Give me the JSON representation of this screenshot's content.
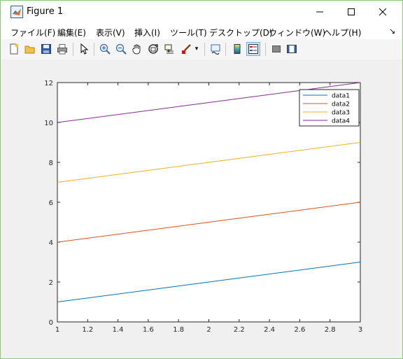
{
  "window": {
    "title": "Figure 1",
    "minimize_glyph": "—",
    "maximize_glyph": "☐",
    "close_glyph": "✕"
  },
  "menu": {
    "items": [
      {
        "id": "file",
        "label": "ファイル(F)"
      },
      {
        "id": "edit",
        "label": "編集(E)"
      },
      {
        "id": "view",
        "label": "表示(V)"
      },
      {
        "id": "insert",
        "label": "挿入(I)"
      },
      {
        "id": "tools",
        "label": "ツール(T)"
      },
      {
        "id": "desktop",
        "label": "デスクトップ(D)"
      },
      {
        "id": "window",
        "label": "ウィンドウ(W)"
      },
      {
        "id": "help",
        "label": "ヘルプ(H)"
      }
    ],
    "dock_glyph": "↘"
  },
  "toolbar": {
    "buttons": [
      {
        "name": "new-figure-icon"
      },
      {
        "name": "open-file-icon"
      },
      {
        "name": "save-icon"
      },
      {
        "name": "print-icon"
      },
      {
        "name": "select-arrow-icon"
      },
      {
        "name": "zoom-in-icon"
      },
      {
        "name": "zoom-out-icon"
      },
      {
        "name": "pan-hand-icon"
      },
      {
        "name": "rotate-3d-icon"
      },
      {
        "name": "data-cursor-icon"
      },
      {
        "name": "brush-icon"
      },
      {
        "name": "link-plot-icon"
      },
      {
        "name": "colorbar-icon"
      },
      {
        "name": "legend-icon"
      },
      {
        "name": "hide-plot-tools-icon"
      },
      {
        "name": "show-plot-tools-icon"
      }
    ],
    "brush_dropdown_glyph": "▾"
  },
  "chart_data": {
    "type": "line",
    "title": "",
    "xlabel": "",
    "ylabel": "",
    "xlim": [
      1,
      3
    ],
    "ylim": [
      0,
      12
    ],
    "xticks": [
      "1",
      "1.2",
      "1.4",
      "1.6",
      "1.8",
      "2",
      "2.2",
      "2.4",
      "2.6",
      "2.8",
      "3"
    ],
    "yticks": [
      "0",
      "2",
      "4",
      "6",
      "8",
      "10",
      "12"
    ],
    "grid": false,
    "legend_position": "top-right",
    "x": [
      1,
      2,
      3
    ],
    "series": [
      {
        "name": "data1",
        "values": [
          1,
          2,
          3
        ],
        "color": "#0072BD"
      },
      {
        "name": "data2",
        "values": [
          4,
          5,
          6
        ],
        "color": "#D95319"
      },
      {
        "name": "data3",
        "values": [
          7,
          8,
          9
        ],
        "color": "#EDB120"
      },
      {
        "name": "data4",
        "values": [
          10,
          11,
          12
        ],
        "color": "#7E2F8E"
      }
    ]
  }
}
